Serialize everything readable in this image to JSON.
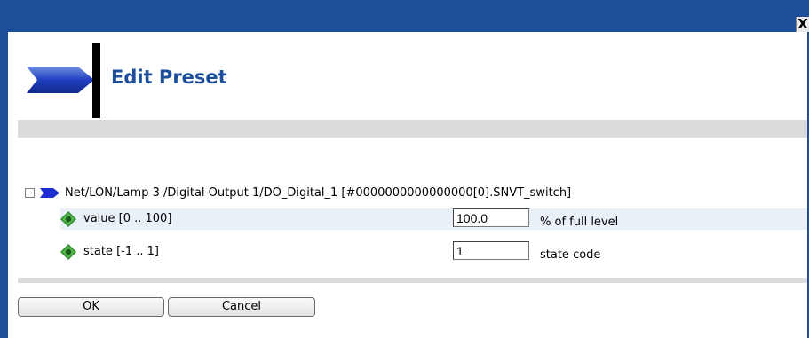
{
  "window": {
    "close_label": "X"
  },
  "header": {
    "title": "Edit Preset"
  },
  "tree": {
    "node_path": "Net/LON/Lamp 3 /Digital Output 1/DO_Digital_1 [#0000000000000000[0].SNVT_switch]"
  },
  "properties": [
    {
      "label": "value [0 .. 100]",
      "value": "100.0",
      "unit": "% of full level"
    },
    {
      "label": "state [-1 .. 1]",
      "value": "1",
      "unit": "state code"
    }
  ],
  "buttons": {
    "ok": "OK",
    "cancel": "Cancel"
  },
  "colors": {
    "brand_blue": "#1c4e9a",
    "band_grey": "#dcdcdc",
    "icon_green": "#2e8b2e"
  }
}
